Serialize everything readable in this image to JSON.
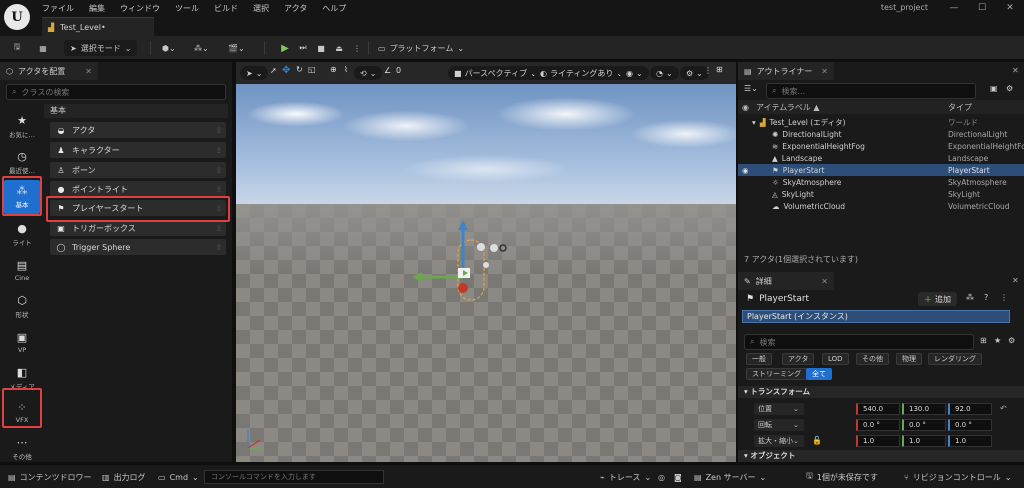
{
  "app": {
    "logo": "U",
    "menus": [
      "ファイル",
      "編集",
      "ウィンドウ",
      "ツール",
      "ビルド",
      "選択",
      "アクタ",
      "ヘルプ"
    ],
    "project": "test_project",
    "level_tab": "Test_Level•"
  },
  "toolbar": {
    "mode_label": "選択モード",
    "platform_label": "プラットフォーム"
  },
  "place_actors": {
    "tab_label": "アクタを配置",
    "search_placeholder": "クラスの検索",
    "categories": [
      {
        "label": "お気に…",
        "icon": "star-icon"
      },
      {
        "label": "最近使…",
        "icon": "clock-icon"
      },
      {
        "label": "基本",
        "icon": "shapes-icon",
        "active": true
      },
      {
        "label": "ライト",
        "icon": "bulb-icon"
      },
      {
        "label": "Cine",
        "icon": "clapper-icon"
      },
      {
        "label": "形状",
        "icon": "cube-icon"
      },
      {
        "label": "VP",
        "icon": "vp-icon"
      },
      {
        "label": "メディア",
        "icon": "media-icon"
      },
      {
        "label": "VFX",
        "icon": "vfx-icon"
      },
      {
        "label": "その他",
        "icon": "more-icon"
      }
    ],
    "section": "基本",
    "items": [
      "アクタ",
      "キャラクター",
      "ポーン",
      "ポイントライト",
      "プレイヤースタート",
      "トリガーボックス",
      "Trigger Sphere"
    ]
  },
  "viewport": {
    "perspective_label": "パースペクティブ",
    "lighting_label": "ライティングあり",
    "rotation_snap": "0"
  },
  "outliner": {
    "tab_label": "アウトライナー",
    "search_placeholder": "検索...",
    "col_label": "アイテムラベル ▲",
    "col_type": "タイプ",
    "level_row": {
      "name": "Test_Level (エディタ)",
      "type": "ワールド"
    },
    "rows": [
      {
        "name": "DirectionalLight",
        "type": "DirectionalLight"
      },
      {
        "name": "ExponentialHeightFog",
        "type": "ExponentialHeightFo"
      },
      {
        "name": "Landscape",
        "type": "Landscape"
      },
      {
        "name": "PlayerStart",
        "type": "PlayerStart",
        "selected": true
      },
      {
        "name": "SkyAtmosphere",
        "type": "SkyAtmosphere"
      },
      {
        "name": "SkyLight",
        "type": "SkyLight"
      },
      {
        "name": "VolumetricCloud",
        "type": "VolumetricCloud"
      }
    ],
    "status": "7 アクタ(1個選択されています)"
  },
  "details": {
    "tab_label": "詳細",
    "title": "PlayerStart",
    "add_label": "追加",
    "instance_label": "PlayerStart (インスタンス)",
    "search_placeholder": "検索",
    "filters_row1": [
      "一般",
      "アクタ",
      "LOD",
      "その他",
      "物理",
      "レンダリング"
    ],
    "filters_row2": [
      "ストリーミング",
      "全て"
    ],
    "transform_section": "トランスフォーム",
    "object_section": "オブジェクト",
    "location_label": "位置",
    "rotation_label": "回転",
    "scale_label": "拡大・縮小",
    "location": [
      "540.0",
      "130.0",
      "92.0"
    ],
    "rotation": [
      "0.0 °",
      "0.0 °",
      "0.0 °"
    ],
    "scale": [
      "1.0",
      "1.0",
      "1.0"
    ]
  },
  "bottom": {
    "content_drawer": "コンテンツドロワー",
    "output_log": "出力ログ",
    "cmd": "Cmd",
    "console_placeholder": "コンソールコマンドを入力します",
    "trace": "トレース",
    "zen": "Zen サーバー",
    "unsaved": "1個が未保存です",
    "revision": "リビジョンコントロール"
  }
}
